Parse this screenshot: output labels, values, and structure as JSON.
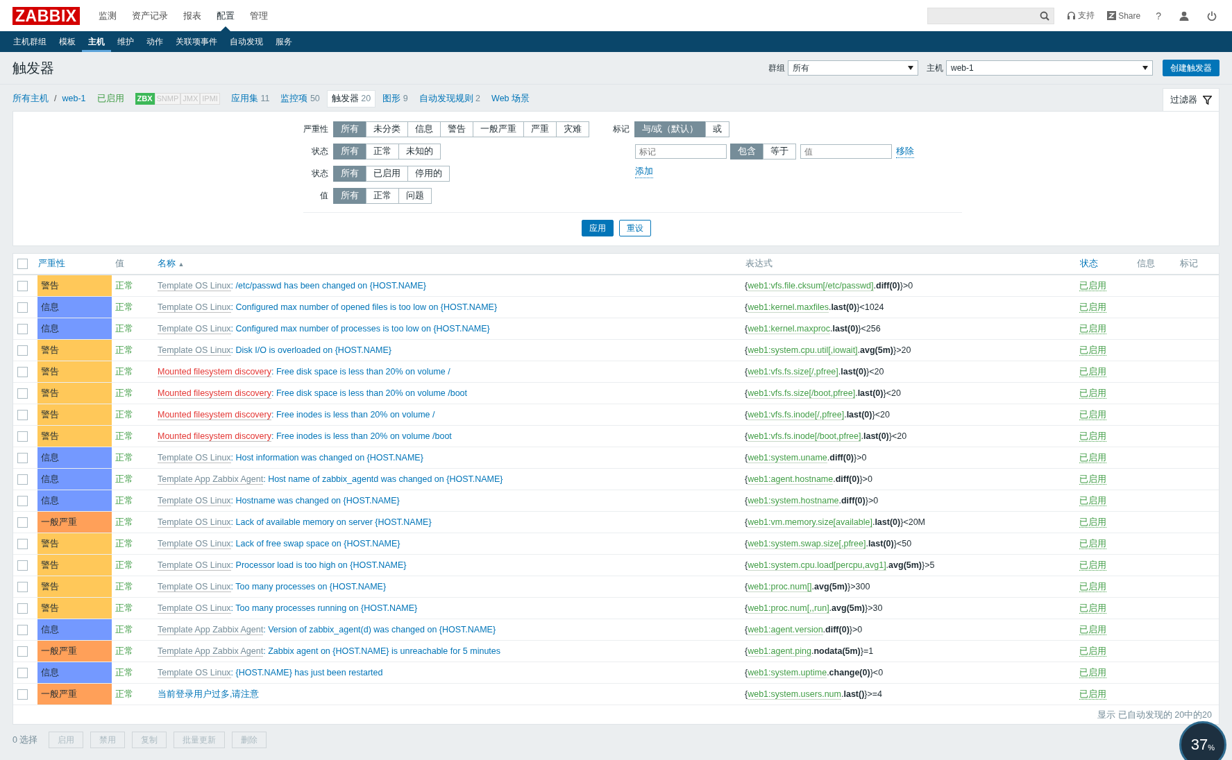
{
  "header": {
    "logo": "ZABBIX",
    "menu": [
      {
        "label": "监测",
        "selected": false
      },
      {
        "label": "资产记录",
        "selected": false
      },
      {
        "label": "报表",
        "selected": false
      },
      {
        "label": "配置",
        "selected": true
      },
      {
        "label": "管理",
        "selected": false
      }
    ],
    "support": "支持",
    "share": "Share",
    "help": "?"
  },
  "submenu": [
    {
      "label": "主机群组",
      "selected": false
    },
    {
      "label": "模板",
      "selected": false
    },
    {
      "label": "主机",
      "selected": true
    },
    {
      "label": "维护",
      "selected": false
    },
    {
      "label": "动作",
      "selected": false
    },
    {
      "label": "关联项事件",
      "selected": false
    },
    {
      "label": "自动发现",
      "selected": false
    },
    {
      "label": "服务",
      "selected": false
    }
  ],
  "page": {
    "title": "触发器",
    "group_label": "群组",
    "group_value": "所有",
    "host_label": "主机",
    "host_value": "web-1",
    "create_button": "创建触发器"
  },
  "breadcrumb": {
    "all_hosts": "所有主机",
    "separator": "/",
    "host": "web-1",
    "status": "已启用",
    "interfaces": [
      {
        "label": "ZBX",
        "on": true
      },
      {
        "label": "SNMP",
        "on": false
      },
      {
        "label": "JMX",
        "on": false
      },
      {
        "label": "IPMI",
        "on": false
      }
    ],
    "tabs": [
      {
        "label": "应用集",
        "count": "11",
        "selected": false
      },
      {
        "label": "监控项",
        "count": "50",
        "selected": false
      },
      {
        "label": "触发器",
        "count": "20",
        "selected": true
      },
      {
        "label": "图形",
        "count": "9",
        "selected": false
      },
      {
        "label": "自动发现规则",
        "count": "2",
        "selected": false
      },
      {
        "label": "Web 场景",
        "selected": false
      }
    ],
    "filter_tab": "过滤器"
  },
  "filter": {
    "groups": [
      {
        "label": "严重性",
        "options": [
          {
            "label": "所有",
            "selected": true
          },
          {
            "label": "未分类",
            "selected": false
          },
          {
            "label": "信息",
            "selected": false
          },
          {
            "label": "警告",
            "selected": false
          },
          {
            "label": "一般严重",
            "selected": false
          },
          {
            "label": "严重",
            "selected": false
          },
          {
            "label": "灾难",
            "selected": false
          }
        ]
      },
      {
        "label": "状态",
        "options": [
          {
            "label": "所有",
            "selected": true
          },
          {
            "label": "正常",
            "selected": false
          },
          {
            "label": "未知的",
            "selected": false
          }
        ]
      },
      {
        "label": "状态",
        "options": [
          {
            "label": "所有",
            "selected": true
          },
          {
            "label": "已启用",
            "selected": false
          },
          {
            "label": "停用的",
            "selected": false
          }
        ]
      },
      {
        "label": "值",
        "options": [
          {
            "label": "所有",
            "selected": true
          },
          {
            "label": "正常",
            "selected": false
          },
          {
            "label": "问题",
            "selected": false
          }
        ]
      }
    ],
    "tags": {
      "label": "标记",
      "modes": [
        {
          "label": "与/或（默认）",
          "selected": true
        },
        {
          "label": "或",
          "selected": false
        }
      ],
      "tag_placeholder": "标记",
      "operators": [
        {
          "label": "包含",
          "selected": true
        },
        {
          "label": "等于",
          "selected": false
        }
      ],
      "value_placeholder": "值",
      "remove": "移除",
      "add": "添加"
    },
    "apply": "应用",
    "reset": "重设"
  },
  "table": {
    "select_all_checked": false,
    "columns": [
      {
        "label": "严重性",
        "sortable": true
      },
      {
        "label": "值",
        "sortable": false
      },
      {
        "label": "名称",
        "sortable": true,
        "sort": "▲"
      },
      {
        "label": "表达式",
        "sortable": false
      },
      {
        "label": "状态",
        "sortable": true
      },
      {
        "label": "信息",
        "sortable": false
      },
      {
        "label": "标记",
        "sortable": false
      }
    ],
    "rows": [
      {
        "checked": false,
        "severity": "警告",
        "color": "#ffc859",
        "value": "正常",
        "source": {
          "text": "Template OS Linux",
          "kind": "template"
        },
        "name": ": /etc/passwd has been changed on {HOST.NAME}",
        "expr": {
          "open": "{",
          "item": "web1:vfs.file.cksum[/etc/passwd]",
          "rest": ".**diff(0)**}>0"
        },
        "status": "已启用"
      },
      {
        "checked": false,
        "severity": "信息",
        "color": "#7499ff",
        "value": "正常",
        "source": {
          "text": "Template OS Linux",
          "kind": "template"
        },
        "name": ": Configured max number of opened files is too low on {HOST.NAME}",
        "expr": {
          "open": "{",
          "item": "web1:kernel.maxfiles",
          "rest": ".**last(0)**}<1024"
        },
        "status": "已启用"
      },
      {
        "checked": false,
        "severity": "信息",
        "color": "#7499ff",
        "value": "正常",
        "source": {
          "text": "Template OS Linux",
          "kind": "template"
        },
        "name": ": Configured max number of processes is too low on {HOST.NAME}",
        "expr": {
          "open": "{",
          "item": "web1:kernel.maxproc",
          "rest": ".**last(0)**}<256"
        },
        "status": "已启用"
      },
      {
        "checked": false,
        "severity": "警告",
        "color": "#ffc859",
        "value": "正常",
        "source": {
          "text": "Template OS Linux",
          "kind": "template"
        },
        "name": ": Disk I/O is overloaded on {HOST.NAME}",
        "expr": {
          "open": "{",
          "item": "web1:system.cpu.util[,iowait]",
          "rest": ".**avg(5m)**}>20"
        },
        "status": "已启用"
      },
      {
        "checked": false,
        "severity": "警告",
        "color": "#ffc859",
        "value": "正常",
        "source": {
          "text": "Mounted filesystem discovery",
          "kind": "discovery"
        },
        "name": ": Free disk space is less than 20% on volume /",
        "expr": {
          "open": "{",
          "item": "web1:vfs.fs.size[/,pfree]",
          "rest": ".**last(0)**}<20"
        },
        "status": "已启用"
      },
      {
        "checked": false,
        "severity": "警告",
        "color": "#ffc859",
        "value": "正常",
        "source": {
          "text": "Mounted filesystem discovery",
          "kind": "discovery"
        },
        "name": ": Free disk space is less than 20% on volume /boot",
        "expr": {
          "open": "{",
          "item": "web1:vfs.fs.size[/boot,pfree]",
          "rest": ".**last(0)**}<20"
        },
        "status": "已启用"
      },
      {
        "checked": false,
        "severity": "警告",
        "color": "#ffc859",
        "value": "正常",
        "source": {
          "text": "Mounted filesystem discovery",
          "kind": "discovery"
        },
        "name": ": Free inodes is less than 20% on volume /",
        "expr": {
          "open": "{",
          "item": "web1:vfs.fs.inode[/,pfree]",
          "rest": ".**last(0)**}<20"
        },
        "status": "已启用"
      },
      {
        "checked": false,
        "severity": "警告",
        "color": "#ffc859",
        "value": "正常",
        "source": {
          "text": "Mounted filesystem discovery",
          "kind": "discovery"
        },
        "name": ": Free inodes is less than 20% on volume /boot",
        "expr": {
          "open": "{",
          "item": "web1:vfs.fs.inode[/boot,pfree]",
          "rest": ".**last(0)**}<20"
        },
        "status": "已启用"
      },
      {
        "checked": false,
        "severity": "信息",
        "color": "#7499ff",
        "value": "正常",
        "source": {
          "text": "Template OS Linux",
          "kind": "template"
        },
        "name": ": Host information was changed on {HOST.NAME}",
        "expr": {
          "open": "{",
          "item": "web1:system.uname",
          "rest": ".**diff(0)**}>0"
        },
        "status": "已启用"
      },
      {
        "checked": false,
        "severity": "信息",
        "color": "#7499ff",
        "value": "正常",
        "source": {
          "text": "Template App Zabbix Agent",
          "kind": "template"
        },
        "name": ": Host name of zabbix_agentd was changed on {HOST.NAME}",
        "expr": {
          "open": "{",
          "item": "web1:agent.hostname",
          "rest": ".**diff(0)**}>0"
        },
        "status": "已启用"
      },
      {
        "checked": false,
        "severity": "信息",
        "color": "#7499ff",
        "value": "正常",
        "source": {
          "text": "Template OS Linux",
          "kind": "template"
        },
        "name": ": Hostname was changed on {HOST.NAME}",
        "expr": {
          "open": "{",
          "item": "web1:system.hostname",
          "rest": ".**diff(0)**}>0"
        },
        "status": "已启用"
      },
      {
        "checked": false,
        "severity": "一般严重",
        "color": "#ffa059",
        "value": "正常",
        "source": {
          "text": "Template OS Linux",
          "kind": "template"
        },
        "name": ": Lack of available memory on server {HOST.NAME}",
        "expr": {
          "open": "{",
          "item": "web1:vm.memory.size[available]",
          "rest": ".**last(0)**}<20M"
        },
        "status": "已启用"
      },
      {
        "checked": false,
        "severity": "警告",
        "color": "#ffc859",
        "value": "正常",
        "source": {
          "text": "Template OS Linux",
          "kind": "template"
        },
        "name": ": Lack of free swap space on {HOST.NAME}",
        "expr": {
          "open": "{",
          "item": "web1:system.swap.size[,pfree]",
          "rest": ".**last(0)**}<50"
        },
        "status": "已启用"
      },
      {
        "checked": false,
        "severity": "警告",
        "color": "#ffc859",
        "value": "正常",
        "source": {
          "text": "Template OS Linux",
          "kind": "template"
        },
        "name": ": Processor load is too high on {HOST.NAME}",
        "expr": {
          "open": "{",
          "item": "web1:system.cpu.load[percpu,avg1]",
          "rest": ".**avg(5m)**}>5"
        },
        "status": "已启用"
      },
      {
        "checked": false,
        "severity": "警告",
        "color": "#ffc859",
        "value": "正常",
        "source": {
          "text": "Template OS Linux",
          "kind": "template"
        },
        "name": ": Too many processes on {HOST.NAME}",
        "expr": {
          "open": "{",
          "item": "web1:proc.num[]",
          "rest": ".**avg(5m)**}>300"
        },
        "status": "已启用"
      },
      {
        "checked": false,
        "severity": "警告",
        "color": "#ffc859",
        "value": "正常",
        "source": {
          "text": "Template OS Linux",
          "kind": "template"
        },
        "name": ": Too many processes running on {HOST.NAME}",
        "expr": {
          "open": "{",
          "item": "web1:proc.num[,,run]",
          "rest": ".**avg(5m)**}>30"
        },
        "status": "已启用"
      },
      {
        "checked": false,
        "severity": "信息",
        "color": "#7499ff",
        "value": "正常",
        "source": {
          "text": "Template App Zabbix Agent",
          "kind": "template"
        },
        "name": ": Version of zabbix_agent(d) was changed on {HOST.NAME}",
        "expr": {
          "open": "{",
          "item": "web1:agent.version",
          "rest": ".**diff(0)**}>0"
        },
        "status": "已启用"
      },
      {
        "checked": false,
        "severity": "一般严重",
        "color": "#ffa059",
        "value": "正常",
        "source": {
          "text": "Template App Zabbix Agent",
          "kind": "template"
        },
        "name": ": Zabbix agent on {HOST.NAME} is unreachable for 5 minutes",
        "expr": {
          "open": "{",
          "item": "web1:agent.ping",
          "rest": ".**nodata(5m)**}=1"
        },
        "status": "已启用"
      },
      {
        "checked": false,
        "severity": "信息",
        "color": "#7499ff",
        "value": "正常",
        "source": {
          "text": "Template OS Linux",
          "kind": "template"
        },
        "name": ": {HOST.NAME} has just been restarted",
        "expr": {
          "open": "{",
          "item": "web1:system.uptime",
          "rest": ".**change(0)**}<0"
        },
        "status": "已启用"
      },
      {
        "checked": false,
        "severity": "一般严重",
        "color": "#ffa059",
        "value": "正常",
        "name": "当前登录用户过多,请注意",
        "expr": {
          "open": "{",
          "item": "web1:system.users.num",
          "rest": ".**last()**}>=4"
        },
        "status": "已启用"
      }
    ],
    "summary": "显示 已自动发现的 20中的20"
  },
  "footer": {
    "selected_count": "0 选择",
    "actions": [
      {
        "label": "启用",
        "disabled": true
      },
      {
        "label": "禁用",
        "disabled": true
      },
      {
        "label": "复制",
        "disabled": true
      },
      {
        "label": "批量更新",
        "disabled": true
      },
      {
        "label": "删除",
        "disabled": true
      }
    ]
  },
  "gauge": {
    "value": "37",
    "unit": "%"
  }
}
